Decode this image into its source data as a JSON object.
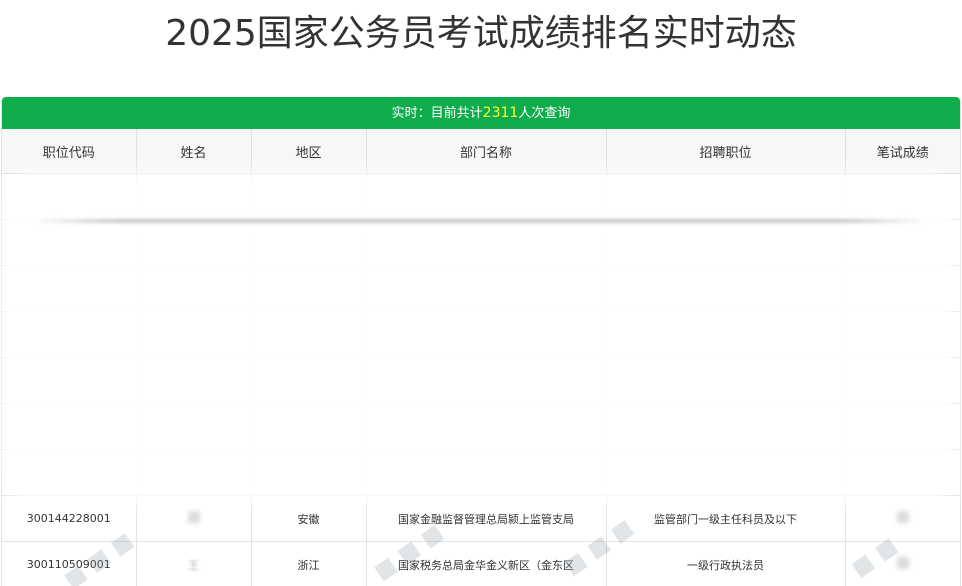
{
  "page": {
    "title": "2025国家公务员考试成绩排名实时动态"
  },
  "status": {
    "prefix": "实时：目前共计",
    "count": "2311",
    "suffix": "人次查询"
  },
  "table": {
    "columns": [
      "职位代码",
      "姓名",
      "地区",
      "部门名称",
      "招聘职位",
      "笔试成绩"
    ],
    "rows": [
      {
        "code": "",
        "name": "",
        "region": "",
        "dept": "",
        "position": "",
        "score": ""
      },
      {
        "code": "",
        "name": "",
        "region": "",
        "dept": "",
        "position": "",
        "score": ""
      },
      {
        "code": "",
        "name": "",
        "region": "",
        "dept": "",
        "position": "",
        "score": ""
      },
      {
        "code": "",
        "name": "",
        "region": "",
        "dept": "",
        "position": "",
        "score": ""
      },
      {
        "code": "",
        "name": "",
        "region": "",
        "dept": "",
        "position": "",
        "score": ""
      },
      {
        "code": "",
        "name": "",
        "region": "",
        "dept": "",
        "position": "",
        "score": ""
      },
      {
        "code": "",
        "name": "",
        "region": "",
        "dept": "",
        "position": "",
        "score": ""
      },
      {
        "code": "300144228001",
        "name": "",
        "region": "安徽",
        "dept": "国家金融监督管理总局颍上监管支局",
        "position": "监管部门一级主任科员及以下",
        "score": ""
      },
      {
        "code": "300110509001",
        "name": "王",
        "region": "浙江",
        "dept": "国家税务总局金华金义新区（金东区",
        "position": "一级行政执法员",
        "score": ""
      }
    ]
  },
  "colors": {
    "accent": "#0eac4a",
    "count_highlight": "#ffff33"
  }
}
